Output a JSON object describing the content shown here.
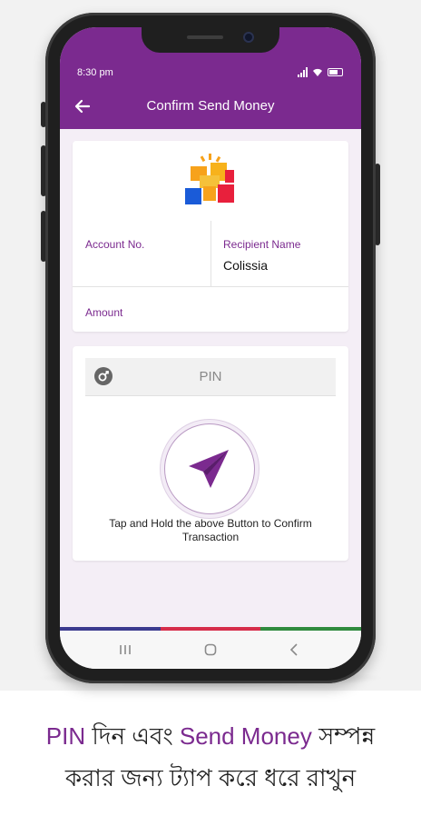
{
  "status_bar": {
    "time": "8:30 pm"
  },
  "app_bar": {
    "title": "Confirm Send Money"
  },
  "account": {
    "account_no_label": "Account No.",
    "recipient_name_label": "Recipient Name",
    "recipient_name_value": "Colissia",
    "amount_label": "Amount"
  },
  "pin": {
    "placeholder": "PIN"
  },
  "send_button": {
    "instruction_line1": "Tap and Hold the above Button to Confirm",
    "instruction_line2": "Transaction"
  },
  "caption": {
    "line1_part1": "PIN",
    "line1_part2": " দিন এবং ",
    "line1_part3": "Send Money",
    "line1_part4": " সম্পন্ন",
    "line2": "করার জন্য ট্যাপ করে ধরে রাখুন"
  },
  "colors": {
    "brand_purple": "#7b2a8f",
    "stripe": [
      "#3b3a8f",
      "#d62c4a",
      "#2f8a3e"
    ]
  },
  "icons": [
    "back-arrow-icon",
    "signal-icon",
    "wifi-icon",
    "battery-icon",
    "lock-icon",
    "send-icon",
    "recent-apps-icon",
    "home-icon",
    "nav-back-icon"
  ]
}
